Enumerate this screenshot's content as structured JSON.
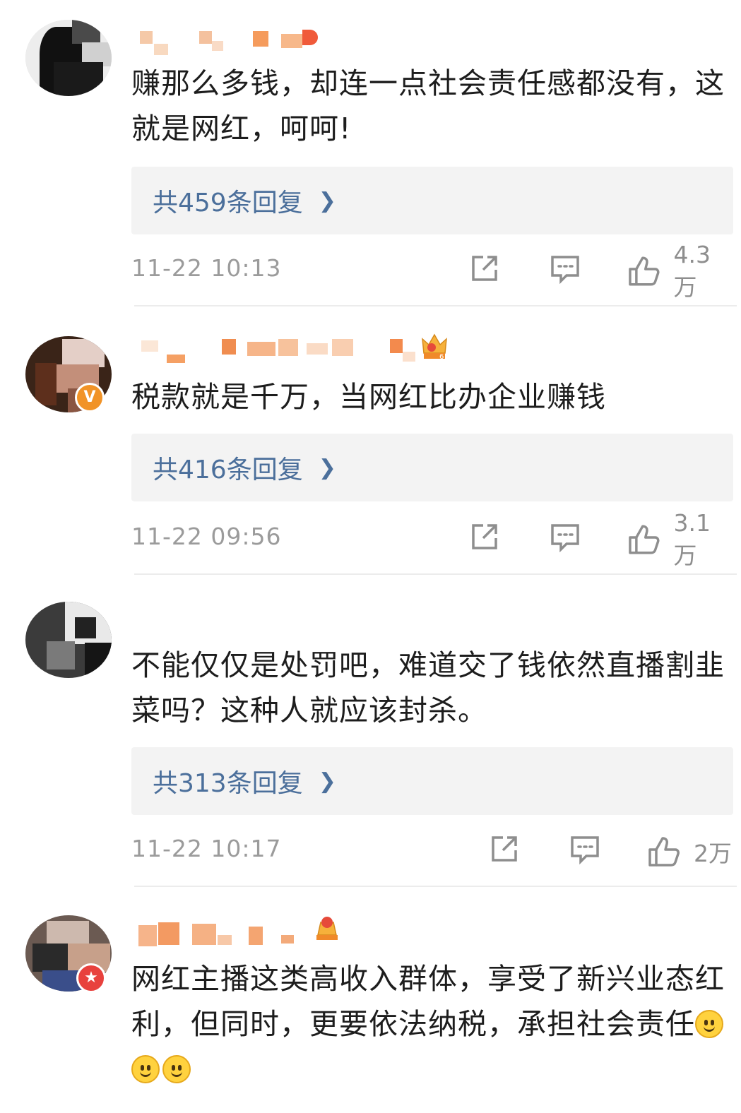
{
  "colors": {
    "reply_link": "#4b6f9b",
    "reply_bg": "#f3f3f3",
    "meta_text": "#9b9b9b",
    "comment_text": "#1d1d1d",
    "badge_orange": "#f19327",
    "badge_red": "#e8413d"
  },
  "comments": [
    {
      "username": "",
      "avatar_blurred": true,
      "badge": null,
      "text": "赚那么多钱，却连一点社会责任感都没有，这就是网红，呵呵!",
      "reply_label": "共459条回复",
      "timestamp": "11-22 10:13",
      "likes": "4.3万",
      "icons": [
        "share-icon",
        "comment-icon",
        "like-icon"
      ]
    },
    {
      "username": "",
      "avatar_blurred": true,
      "badge": "V",
      "badge_icon": "verified-v-icon",
      "level_icon": "crown-level-icon",
      "level_number": "6",
      "text": "税款就是千万，当网红比办企业赚钱",
      "reply_label": "共416条回复",
      "timestamp": "11-22 09:56",
      "likes": "3.1万",
      "icons": [
        "share-icon",
        "comment-icon",
        "like-icon"
      ]
    },
    {
      "username": "",
      "avatar_blurred": true,
      "badge": null,
      "text": "不能仅仅是处罚吧，难道交了钱依然直播割韭菜吗？这种人就应该封杀。",
      "reply_label": "共313条回复",
      "timestamp": "11-22 10:17",
      "likes": "2万",
      "icons": [
        "share-icon",
        "comment-icon",
        "like-icon"
      ]
    },
    {
      "username": "",
      "avatar_blurred": true,
      "badge": "★",
      "badge_icon": "star-badge-icon",
      "level_icon": "crown-level-icon",
      "text": "网红主播这类高收入群体，享受了新兴业态红利，但同时，更要依法纳税，承担社会责任",
      "emoji": [
        "smile-emoji",
        "smile-emoji",
        "smile-emoji"
      ]
    }
  ]
}
